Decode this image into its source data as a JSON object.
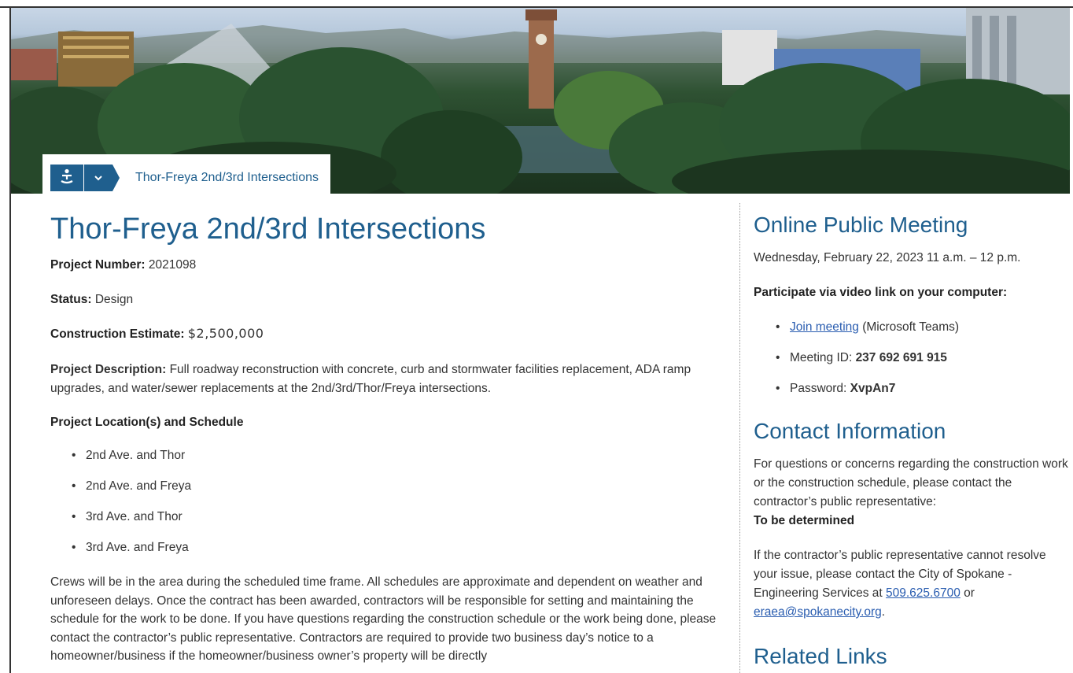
{
  "banner": {
    "alt": "Spokane skyline with clock tower and trees"
  },
  "breadcrumb": {
    "home_icon": "accessibility-person-icon",
    "menu_icon": "chevron-down-icon",
    "current": "Thor-Freya 2nd/3rd Intersections"
  },
  "main": {
    "title": "Thor-Freya 2nd/3rd Intersections",
    "project_number_label": "Project Number:",
    "project_number": "2021098",
    "status_label": "Status:",
    "status": "Design",
    "estimate_label": "Construction Estimate:",
    "estimate_currency": "$",
    "estimate": "2,500,000",
    "description_label": "Project Description:",
    "description": "Full roadway reconstruction with concrete, curb and stormwater facilities replacement, ADA ramp upgrades, and water/sewer replacements at the 2nd/3rd/Thor/Freya intersections.",
    "locations_heading": "Project Location(s) and Schedule",
    "locations": [
      "2nd Ave. and Thor",
      "2nd Ave. and Freya",
      "3rd Ave. and Thor",
      "3rd Ave. and Freya"
    ],
    "crews_text": "Crews will be in the area during the scheduled time frame. All schedules are approximate and dependent on weather and unforeseen delays. Once the contract has been awarded, contractors will be responsible for setting and maintaining the schedule for the work to be done. If you have questions regarding the construction schedule or the work being done, please contact the contractor’s public representative. Contractors are required to provide two business day’s notice to a homeowner/business if the homeowner/business owner’s property will be directly"
  },
  "sidebar": {
    "meeting_heading": "Online Public Meeting",
    "meeting_datetime": "Wednesday, February 22, 2023 11 a.m. – 12 p.m.",
    "participate_label": "Participate via video link on your computer:",
    "join_link": "Join meeting",
    "join_suffix": " (Microsoft Teams)",
    "meeting_id_label": "Meeting ID: ",
    "meeting_id": "237 692 691 915",
    "password_label": "Password: ",
    "password": "XvpAn7",
    "contact_heading": "Contact Information",
    "contact_text": "For questions or concerns regarding the construction work or the construction schedule, please contact the contractor’s public representative:",
    "contact_rep": "To be determined",
    "fallback_text": "If the contractor’s public representative cannot resolve your issue, please contact the City of Spokane - Engineering Services at ",
    "phone": "509.625.6700",
    "or_text": " or ",
    "email": "eraea@spokanecity.org",
    "period": ".",
    "related_heading": "Related Links"
  },
  "colors": {
    "heading_blue": "#1f5f8e",
    "link_blue": "#2a5db0",
    "body_text": "#333333"
  }
}
